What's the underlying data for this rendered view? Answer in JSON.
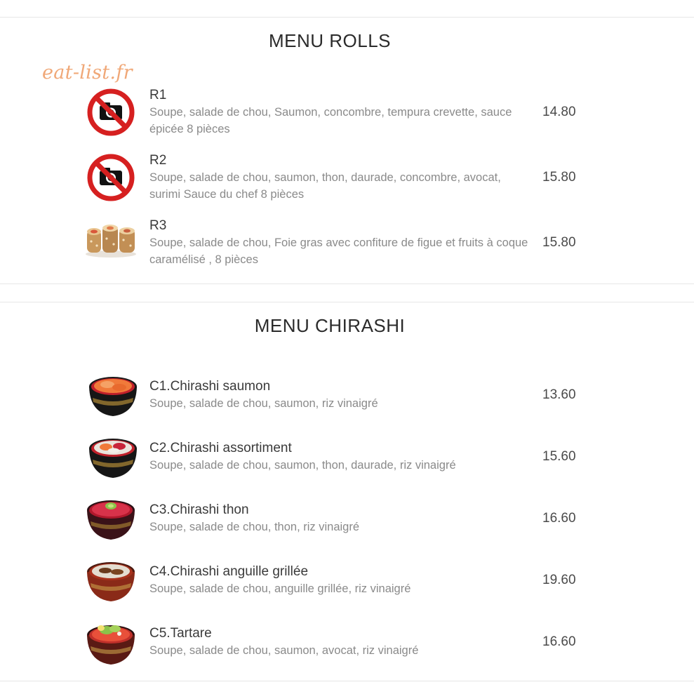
{
  "watermark": "eat-list.fr",
  "sections": [
    {
      "title": "MENU ROLLS",
      "items": [
        {
          "name": "R1",
          "desc": "Soupe, salade de chou, Saumon, concombre, tempura crevette, sauce épicée 8 pièces",
          "price": "14.80",
          "image": "no-photo-icon"
        },
        {
          "name": "R2",
          "desc": "Soupe, salade de chou, saumon, thon, daurade, concombre, avocat, surimi Sauce du chef 8 pièces",
          "price": "15.80",
          "image": "no-photo-icon"
        },
        {
          "name": "R3",
          "desc": "Soupe, salade de chou, Foie gras avec confiture de figue et fruits à coque caramélisé ,   8 pièces",
          "price": "15.80",
          "image": "sushi-roll-photo"
        }
      ]
    },
    {
      "title": "MENU CHIRASHI",
      "items": [
        {
          "name": "C1.Chirashi saumon",
          "desc": "Soupe, salade de chou, saumon, riz vinaigré",
          "price": "13.60",
          "image": "chirashi-bowl-photo"
        },
        {
          "name": "C2.Chirashi assortiment",
          "desc": "Soupe, salade de chou, saumon, thon, daurade, riz vinaigré",
          "price": "15.60",
          "image": "chirashi-bowl-photo"
        },
        {
          "name": "C3.Chirashi thon",
          "desc": "Soupe, salade de chou, thon, riz vinaigré",
          "price": "16.60",
          "image": "chirashi-bowl-photo"
        },
        {
          "name": "C4.Chirashi anguille grillée",
          "desc": "Soupe, salade de chou, anguille grillée, riz vinaigré",
          "price": "19.60",
          "image": "chirashi-bowl-photo"
        },
        {
          "name": "C5.Tartare",
          "desc": "Soupe, salade de chou, saumon, avocat, riz vinaigré",
          "price": "16.60",
          "image": "chirashi-bowl-photo"
        }
      ]
    }
  ]
}
